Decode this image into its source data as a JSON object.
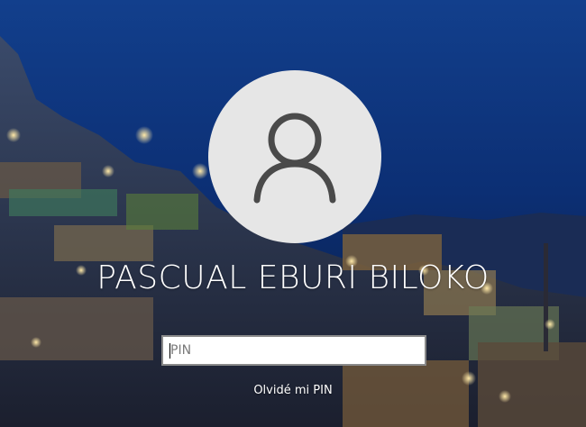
{
  "lock_screen": {
    "user_name": "PASCUAL EBURI BILOKO",
    "avatar_icon": "user-icon",
    "pin_placeholder": "PIN",
    "pin_value": "",
    "forgot_pin_label": "Olvidé mi PIN"
  },
  "colors": {
    "sky": "#0b2a6a",
    "avatar_bg": "#e6e6e6",
    "avatar_glyph": "#4a4a4a",
    "text": "#ffffff"
  }
}
